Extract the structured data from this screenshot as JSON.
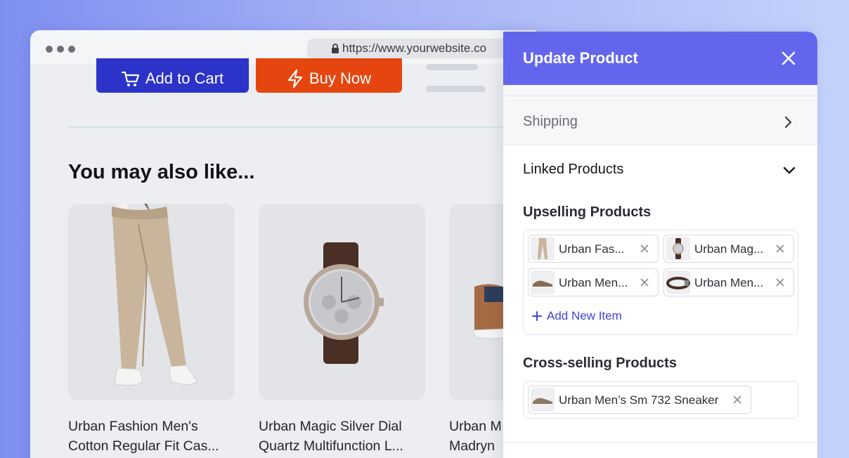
{
  "browser": {
    "url": "https://www.yourwebsite.co",
    "add_to_cart_label": "Add to Cart",
    "buy_now_label": "Buy Now",
    "section_title": "You may also like...",
    "products": [
      {
        "title_line1": "Urban Fashion Men's",
        "title_line2": "Cotton Regular Fit Cas..."
      },
      {
        "title_line1": "Urban Magic Silver Dial",
        "title_line2": "Quartz Multifunction L..."
      },
      {
        "title_line1": "Urban M",
        "title_line2": "Madryn"
      }
    ]
  },
  "panel": {
    "title": "Update Product",
    "shipping_label": "Shipping",
    "linked_products_label": "Linked Products",
    "upselling_title": "Upselling Products",
    "upselling_items": [
      {
        "label": "Urban Fas...",
        "icon": "pants-thumbnail"
      },
      {
        "label": "Urban Mag...",
        "icon": "watch-thumbnail"
      },
      {
        "label": "Urban Men...",
        "icon": "sneaker-thumbnail"
      },
      {
        "label": "Urban Men...",
        "icon": "belt-thumbnail"
      }
    ],
    "add_new_item_label": "Add New Item",
    "cross_selling_title": "Cross-selling Products",
    "cross_selling_items": [
      {
        "label": "Urban Men’s Sm 732 Sneaker",
        "icon": "sneaker-thumbnail"
      }
    ]
  },
  "colors": {
    "panel_header": "#6366ec",
    "add_to_cart": "#2c33c9",
    "buy_now": "#e5460f",
    "link_accent": "#3d44d6"
  }
}
